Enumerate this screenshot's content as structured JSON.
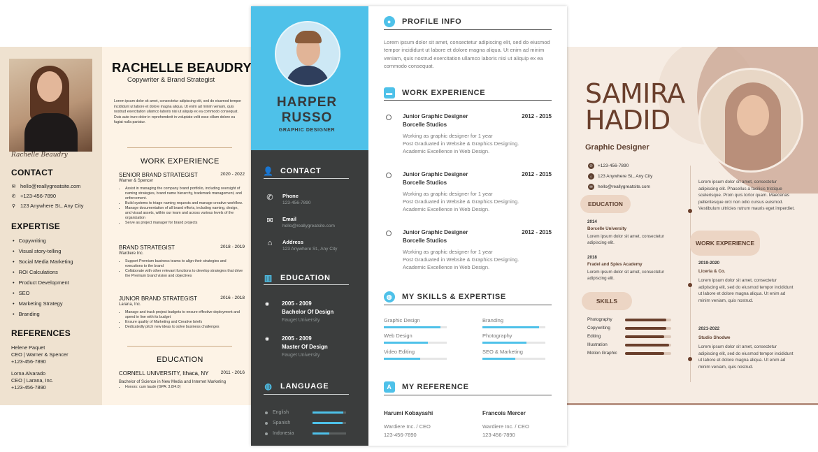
{
  "left": {
    "name": "RACHELLE BEAUDRY",
    "subtitle": "Copywriter & Brand Strategist",
    "signature": "Rachelle Beaudry",
    "intro": "Lorem ipsum dolor sit amet, consectetur adipiscing elit, sed do eiusmod tempor incididunt ut labore et dolore magna aliqua. Ut enim ad minim veniam, quis nostrud exercitation ullamco laboris nisi ut aliquip ex ea commodo consequat. Duis aute irure dolor in reprehenderit in voluptate velit esse cillum dolore eu fugiat nulla pariatur.",
    "contact_title": "CONTACT",
    "contact": {
      "email": "hello@reallygreatsite.com",
      "phone": "+123-456-7890",
      "address": "123 Anywhere St., Any City"
    },
    "expertise_title": "EXPERTISE",
    "expertise": [
      "Copywriting",
      "Visual story-telling",
      "Social Media Marketing",
      "ROI Calculations",
      "Product Development",
      "SEO",
      "Marketing Strategy",
      "Branding"
    ],
    "references_title": "REFERENCES",
    "references": [
      {
        "name": "Helene Paquet",
        "company": "CEO | Warner & Spencer",
        "phone": "+123-456-7890"
      },
      {
        "name": "Lorna Alvarado",
        "company": "CEO | Larana, Inc.",
        "phone": "+123-456-7890"
      }
    ],
    "work_title": "WORK EXPERIENCE",
    "jobs": [
      {
        "title": "SENIOR BRAND STRATEGIST",
        "years": "2020 - 2022",
        "company": "Warner & Spencer",
        "bullets": [
          "Assist in managing the company brand portfolio, including oversight of naming strategies, brand name hierarchy, trademark management, and enforcement.",
          "Build systems to triage naming requests and manage creative workflow.",
          "Manage documentation of all brand efforts, including naming, design, and visual assets, within our team and across various levels of the organization",
          "Serve as project manager for brand projects"
        ]
      },
      {
        "title": "BRAND STRATEGIST",
        "years": "2018 - 2019",
        "company": "Wardiere Inc.",
        "bullets": [
          "Support Premium business teams to align their strategies and executions to the brand",
          "Collaborate with other relevant functions to develop strategies that drive the Premium brand vision and objectives"
        ]
      },
      {
        "title": "JUNIOR BRAND STRATEGIST",
        "years": "2016 - 2018",
        "company": "Larana, Inc.",
        "bullets": [
          "Manage and track project budgets to ensure effective deployment and spend in line with its budget",
          "Ensure quality of Marketing and Creative briefs",
          "Dedicatedly pitch new ideas to solve business challenges"
        ]
      }
    ],
    "education_title": "EDUCATION",
    "education": {
      "school": "CORNELL UNIVERSITY, Ithaca, NY",
      "years": "2011 - 2016",
      "degree": "Bachelor of Science in New Media and Internet Marketing",
      "honor": "Honors: cum laude (GPA: 3.8/4.0)"
    }
  },
  "mid": {
    "name_first": "HARPER",
    "name_last": "RUSSO",
    "role": "GRAPHIC DESIGNER",
    "contact_title": "CONTACT",
    "contact": [
      {
        "label": "Phone",
        "value": "123-456-7890",
        "icon": "phone-icon"
      },
      {
        "label": "Email",
        "value": "hello@reallygreatsite.com",
        "icon": "mail-icon"
      },
      {
        "label": "Address",
        "value": "123 Anywhere St., Any City",
        "icon": "home-icon"
      }
    ],
    "education_title": "EDUCATION",
    "education": [
      {
        "years": "2005 - 2009",
        "degree": "Bachelor Of Design",
        "school": "Fauget University"
      },
      {
        "years": "2005 - 2009",
        "degree": "Master Of Design",
        "school": "Fauget University"
      }
    ],
    "language_title": "LANGUAGE",
    "languages": [
      {
        "name": "English",
        "level": 0.92
      },
      {
        "name": "Spanish",
        "level": 0.9
      },
      {
        "name": "Indonesia",
        "level": 0.5
      }
    ],
    "profile_title": "PROFILE INFO",
    "profile": "Lorem ipsum dolor sit amet, consectetur adipiscing elit, sed do eiusmod tempor incididunt ut labore et dolore magna aliqua. Ut enim ad minim veniam, quis nostrud exercitation ullamco laboris nisi ut aliquip ex ea commodo consequat.",
    "work_title": "WORK EXPERIENCE",
    "work": [
      {
        "title": "Junior Graphic Designer",
        "years": "2012 - 2015",
        "company": "Borcelle Studios",
        "desc": "Working as graphic designer for 1 year\nPost Graduated in Website & Graphics Designing.\nAcademic Excellence in Web Design."
      },
      {
        "title": "Junior Graphic Designer",
        "years": "2012 - 2015",
        "company": "Borcelle Studios",
        "desc": "Working as graphic designer for 1 year\nPost Graduated in Website & Graphics Designing.\nAcademic Excellence in Web Design."
      },
      {
        "title": "Junior Graphic Designer",
        "years": "2012 - 2015",
        "company": "Borcelle Studios",
        "desc": "Working as graphic designer for 1 year\nPost Graduated in Website & Graphics Designing.\nAcademic Excellence in Web Design."
      }
    ],
    "skills_title": "MY SKILLS & EXPERTISE",
    "skills": [
      {
        "name": "Graphic Design",
        "level": 0.9
      },
      {
        "name": "Branding",
        "level": 0.9
      },
      {
        "name": "Web Design",
        "level": 0.7
      },
      {
        "name": "Photography",
        "level": 0.7
      },
      {
        "name": "Video Editing",
        "level": 0.58
      },
      {
        "name": "SEO & Marketing",
        "level": 0.52
      }
    ],
    "reference_title": "MY REFERENCE",
    "references": [
      {
        "name": "Harumi Kobayashi",
        "company": "Wardiere Inc. / CEO",
        "phone": "123-456-7890"
      },
      {
        "name": "Francois Mercer",
        "company": "Wardiere Inc. / CEO",
        "phone": "123-456-7890"
      }
    ]
  },
  "right": {
    "name_first": "SAMIRA",
    "name_last": "HADID",
    "role": "Graphic Designer",
    "contact": [
      {
        "value": "+123-456-7890",
        "icon": "phone-icon"
      },
      {
        "value": "123 Anywhere St., Any City",
        "icon": "home-icon"
      },
      {
        "value": "hello@reallygreatsite.com",
        "icon": "mail-icon"
      }
    ],
    "education_title": "EDUCATION",
    "education": [
      {
        "year": "2014",
        "school": "Borcelle University",
        "desc": "Lorem ipsum dolor sit amet, consectetur adipiscing elit."
      },
      {
        "year": "2018",
        "school": "Fradel and Spies Academy",
        "desc": "Lorem ipsum dolor sit amet, consectetur adipiscing elit."
      }
    ],
    "skills_title": "SKILLS",
    "skills": [
      {
        "name": "Photography",
        "level": 0.9
      },
      {
        "name": "Copywriting",
        "level": 0.9
      },
      {
        "name": "Editing",
        "level": 0.85
      },
      {
        "name": "Illustration",
        "level": 0.95
      },
      {
        "name": "Motion Graphic",
        "level": 0.85
      }
    ],
    "about": "Lorem ipsum dolor sit amet, consectetur adipiscing elit. Phasellus a facilisis tristique scelerisque. Proin quis tortor quam. Maecenas pellentesque orci non odio cursus euismod. Vestibulum ultricies rutrum mauris eget imperdiet.",
    "work_title": "WORK EXPERIENCE",
    "work": [
      {
        "years": "2019-2020",
        "company": "Liceria & Co.",
        "desc": "Lorem ipsum dolor sit amet, consectetur adipiscing elit, sed do eiusmod tempor incididunt ut labore et dolore magna aliqua. Ut enim ad minim veniam, quis nostrud."
      },
      {
        "years": "2021-2022",
        "company": "Studio Shodwe",
        "desc": "Lorem ipsum dolor sit amet, consectetur adipiscing elit, sed do eiusmod tempor incididunt ut labore et dolore magna aliqua. Ut enim ad minim veniam, quis nostrud."
      }
    ]
  }
}
